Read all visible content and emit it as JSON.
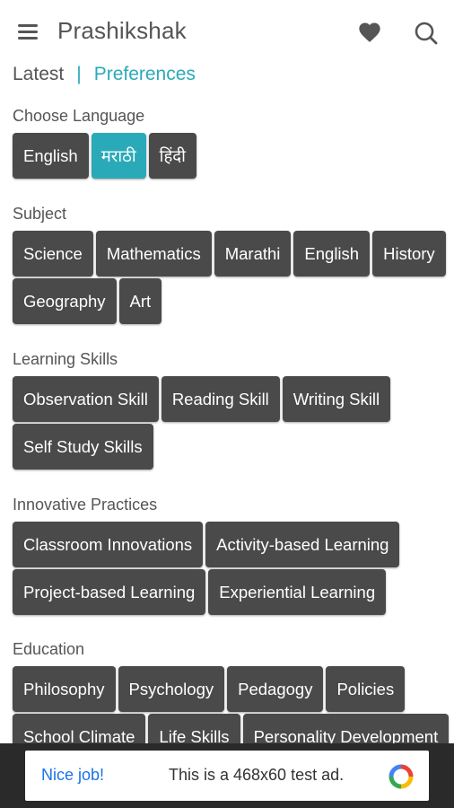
{
  "app_bar": {
    "title": "Prashikshak",
    "menu_icon": "hamburger-menu-icon",
    "favorites_icon": "heart-icon",
    "search_icon": "search-icon"
  },
  "tabs": {
    "latest": "Latest",
    "separator": "|",
    "preferences": "Preferences"
  },
  "sections": {
    "language": {
      "label": "Choose Language",
      "chips": [
        "English",
        "मराठी",
        "हिंदी"
      ],
      "selected": "मराठी"
    },
    "subject": {
      "label": "Subject",
      "chips": [
        "Science",
        "Mathematics",
        "Marathi",
        "English",
        "History",
        "Geography",
        "Art"
      ]
    },
    "learning_skills": {
      "label": "Learning Skills",
      "chips": [
        "Observation Skill",
        "Reading Skill",
        "Writing Skill",
        "Self Study Skills"
      ]
    },
    "innovative_practices": {
      "label": "Innovative Practices",
      "chips": [
        "Classroom Innovations",
        "Activity-based Learning",
        "Project-based Learning",
        "Experiential Learning"
      ]
    },
    "education": {
      "label": "Education",
      "chips": [
        "Philosophy",
        "Psychology",
        "Pedagogy",
        "Policies",
        "School Climate",
        "Life Skills",
        "Personality Development"
      ]
    }
  },
  "ad": {
    "nice_job": "Nice job!",
    "text": "This is a 468x60 test ad."
  },
  "colors": {
    "accent": "#2aaab8",
    "chip_bg": "#4a4a4a",
    "text": "#555555",
    "ad_bar": "#2a2a2a",
    "ad_link": "#1a73e8"
  }
}
